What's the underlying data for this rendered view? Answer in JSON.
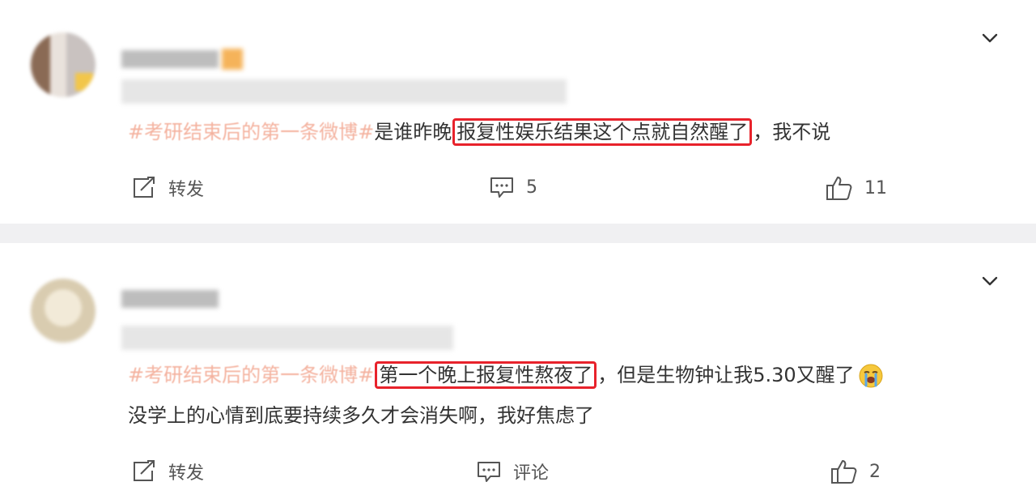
{
  "posts": [
    {
      "hashtag": "#考研结束后的第一条微博#",
      "text_before": "是谁昨晚",
      "highlight": "报复性娱乐结果这个点就自然醒了",
      "text_after": "，我不说",
      "text_line2": "",
      "actions": {
        "repost": "转发",
        "comment": "5",
        "like": "11"
      }
    },
    {
      "hashtag": "#考研结束后的第一条微博#",
      "text_before": "",
      "highlight": "第一个晚上报复性熬夜了",
      "text_after": "，但是生物钟让我5.30又醒了",
      "text_line2": "没学上的心情到底要持续多久才会消失啊，我好焦虑了",
      "actions": {
        "repost": "转发",
        "comment": "评论",
        "like": "2"
      }
    }
  ],
  "colors": {
    "hashtag": "#eb7350",
    "highlight_border": "#e8222b",
    "divider": "#f0f0f2",
    "icon": "#555555"
  },
  "icons": {
    "menu": "chevron-down-icon",
    "repost": "repost-icon",
    "comment": "comment-icon",
    "like": "thumbs-up-icon",
    "emoji": "crying-face-emoji"
  }
}
